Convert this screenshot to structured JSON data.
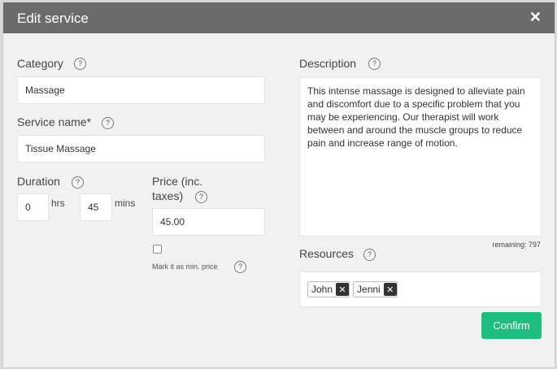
{
  "modal": {
    "title": "Edit service",
    "close_icon": "close-icon"
  },
  "category": {
    "label": "Category",
    "value": "Massage",
    "help": "?"
  },
  "service_name": {
    "label": "Service name*",
    "value": "Tissue Massage",
    "help": "?"
  },
  "duration": {
    "label": "Duration",
    "help": "?",
    "hours": "0",
    "hours_unit": "hrs",
    "minutes": "45",
    "minutes_unit": "mins"
  },
  "price": {
    "label_line1": "Price (inc.",
    "label_line2": "taxes)",
    "help": "?",
    "value": "45.00",
    "min_price_label": "Mark it as min. price",
    "min_price_help": "?",
    "min_price_checked": false
  },
  "description": {
    "label": "Description",
    "help": "?",
    "value": "This intense massage is designed to alleviate pain and discomfort due to a specific problem that you may be experiencing. Our therapist will work between and around the muscle groups to reduce pain and increase range of motion.",
    "remaining": "remaining: 797"
  },
  "resources": {
    "label": "Resources",
    "help": "?",
    "items": [
      {
        "name": "John",
        "remove": "✕"
      },
      {
        "name": "Jenni",
        "remove": "✕"
      }
    ]
  },
  "confirm_label": "Confirm",
  "colors": {
    "header": "#6b6b6b",
    "confirm": "#1cbf7e",
    "body": "#f1f1f1"
  }
}
